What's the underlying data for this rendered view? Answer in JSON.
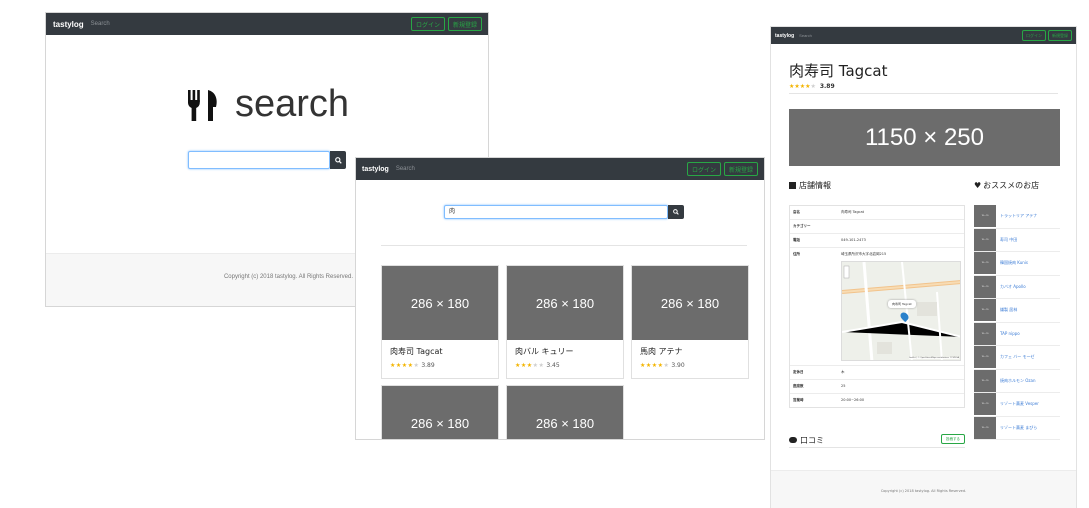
{
  "home": {
    "brand": "tastylog",
    "nav_link": "Search",
    "login_label": "ログイン",
    "signup_label": "新規登録",
    "hero_text": "search",
    "search_button_icon": "search-icon",
    "copyright": "Copyright (c) 2018 tastylog. All Rights Reserved."
  },
  "results": {
    "brand": "tastylog",
    "nav_link": "Search",
    "login_label": "ログイン",
    "signup_label": "新規登録",
    "search_value": "肉",
    "cards": [
      {
        "image": "286 × 180",
        "name": "肉寿司 Tagcat",
        "stars": "★★★★",
        "stars_off": "★",
        "score": "3.89"
      },
      {
        "image": "286 × 180",
        "name": "肉バル キュリー",
        "stars": "★★★",
        "stars_off": "★★",
        "score": "3.45"
      },
      {
        "image": "286 × 180",
        "name": "馬肉 アテナ",
        "stars": "★★★★",
        "stars_off": "★",
        "score": "3.90"
      },
      {
        "image": "286 × 180"
      },
      {
        "image": "286 × 180"
      }
    ]
  },
  "detail": {
    "brand": "tastylog",
    "nav_link": "Search",
    "login_label": "ログイン",
    "signup_label": "新規登録",
    "shop_title": "肉寿司 Tagcat",
    "stars": "★★★★",
    "stars_off": "★",
    "score": "3.89",
    "banner": "1150 × 250",
    "info_heading": "店舗情報",
    "recs_heading": "おススメのお店",
    "info_rows": [
      {
        "k": "店名",
        "v": "肉寿司 Tagcat"
      },
      {
        "k": "カテゴリー",
        "v": ""
      },
      {
        "k": "電話",
        "v": "049-101-2473"
      },
      {
        "k": "住所",
        "v": "埼玉県所沢市大字北岩岡215"
      }
    ],
    "info_rows_after": [
      {
        "k": "定休日",
        "v": "木"
      },
      {
        "k": "座席数",
        "v": "25"
      },
      {
        "k": "営業時",
        "v": "20:00~26:00"
      }
    ],
    "map_popup": "肉寿司 Tagcat",
    "map_attribution": "Leaflet | © OpenStreetMap contributors, CC-BY-SA",
    "recommendations": [
      "トラットリア アテナ",
      "寿司 中田",
      "韓国焼肉 Kunis",
      "カバオ Apollo",
      "燻製 居林",
      "TAP nippo",
      "カフェ バー モーゼ",
      "焼肉ホルモン Ozan",
      "リゾート蕎麦 Vesper",
      "リゾート蕎麦 まぴら"
    ],
    "rec_image": "70 × 70",
    "reviews_heading": "口コミ",
    "post_review_label": "投稿する",
    "copyright": "Copyright (c) 2018 tastylog. All Rights Reserved."
  },
  "colors": {
    "navbar": "#343a40",
    "accent_green": "#28a745",
    "placeholder_gray": "#6c6c6c",
    "star_yellow": "#f3b400",
    "link_blue": "#3a7bd5"
  }
}
